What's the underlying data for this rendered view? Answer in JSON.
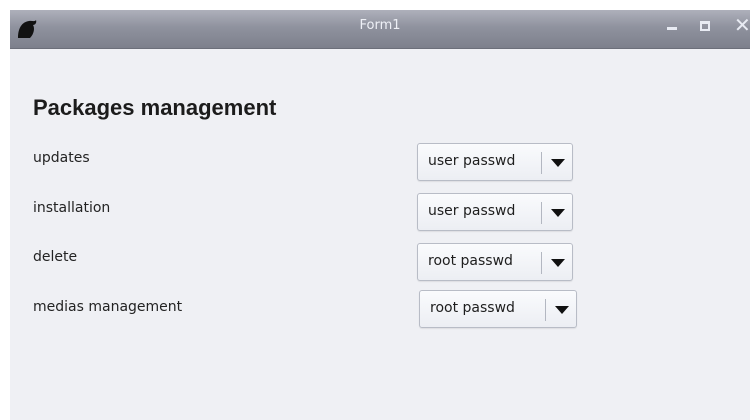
{
  "window": {
    "title": "Form1"
  },
  "form": {
    "heading": "Packages management",
    "rows": [
      {
        "label": "updates",
        "value": "user passwd"
      },
      {
        "label": "installation",
        "value": "user passwd"
      },
      {
        "label": "delete",
        "value": "root passwd"
      },
      {
        "label": "medias management",
        "value": "root passwd"
      }
    ]
  },
  "icons": {
    "app": "app-logo-icon",
    "minimize": "minimize-icon",
    "maximize": "maximize-icon",
    "close": "close-icon",
    "dropdown": "chevron-down-icon"
  },
  "colors": {
    "titlebar": "#8f929e",
    "window_bg": "#eff0f4",
    "title_text": "#eef0f6"
  }
}
